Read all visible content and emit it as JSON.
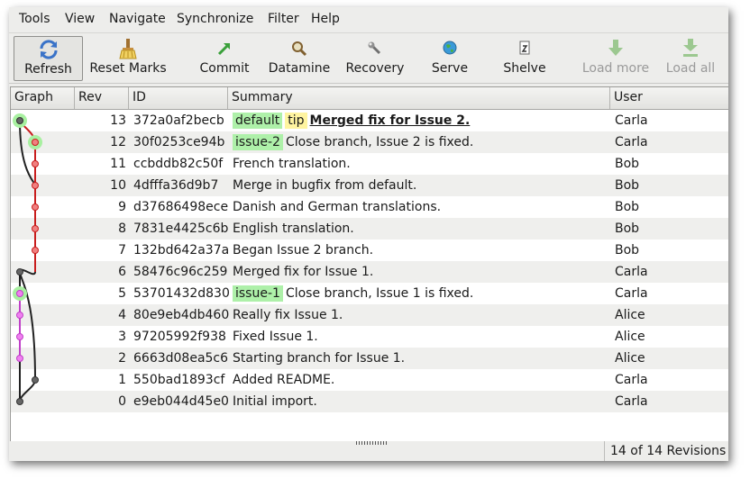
{
  "menu": [
    "Tools",
    "View",
    "Navigate",
    "Synchronize",
    "Filter",
    "Help"
  ],
  "toolbar": {
    "refresh": "Refresh",
    "reset_marks": "Reset Marks",
    "commit": "Commit",
    "datamine": "Datamine",
    "recovery": "Recovery",
    "serve": "Serve",
    "shelve": "Shelve",
    "load_more": "Load more",
    "load_all": "Load all"
  },
  "columns": {
    "graph": "Graph",
    "rev": "Rev",
    "id": "ID",
    "summary": "Summary",
    "user": "User"
  },
  "revisions": [
    {
      "rev": "13",
      "id": "372a0af2becb",
      "tags": [
        "default",
        "tip"
      ],
      "summary": "Merged fix for Issue 2.",
      "user": "Carla",
      "bold": true
    },
    {
      "rev": "12",
      "id": "30f0253ce94b",
      "tags": [
        "issue-2"
      ],
      "summary": "Close branch, Issue 2 is fixed.",
      "user": "Carla"
    },
    {
      "rev": "11",
      "id": "ccbddb82c50f",
      "tags": [],
      "summary": "French translation.",
      "user": "Bob"
    },
    {
      "rev": "10",
      "id": "4dfffa36d9b7",
      "tags": [],
      "summary": "Merge in bugfix from default.",
      "user": "Bob"
    },
    {
      "rev": "9",
      "id": "d37686498ece",
      "tags": [],
      "summary": "Danish and German translations.",
      "user": "Bob"
    },
    {
      "rev": "8",
      "id": "7831e4425c6b",
      "tags": [],
      "summary": "English translation.",
      "user": "Bob"
    },
    {
      "rev": "7",
      "id": "132bd642a37a",
      "tags": [],
      "summary": "Began Issue 2 branch.",
      "user": "Bob"
    },
    {
      "rev": "6",
      "id": "58476c96c259",
      "tags": [],
      "summary": "Merged fix for Issue 1.",
      "user": "Carla"
    },
    {
      "rev": "5",
      "id": "53701432d830",
      "tags": [
        "issue-1"
      ],
      "summary": "Close branch, Issue 1 is fixed.",
      "user": "Carla"
    },
    {
      "rev": "4",
      "id": "80e9eb4db460",
      "tags": [],
      "summary": "Really fix Issue 1.",
      "user": "Alice"
    },
    {
      "rev": "3",
      "id": "97205992f938",
      "tags": [],
      "summary": "Fixed Issue 1.",
      "user": "Alice"
    },
    {
      "rev": "2",
      "id": "6663d08ea5c6",
      "tags": [],
      "summary": "Starting branch for Issue 1.",
      "user": "Alice"
    },
    {
      "rev": "1",
      "id": "550bad1893cf",
      "tags": [],
      "summary": "Added README.",
      "user": "Carla"
    },
    {
      "rev": "0",
      "id": "e9eb044d45e0",
      "tags": [],
      "summary": "Initial import.",
      "user": "Carla"
    }
  ],
  "status": "14 of 14 Revisions",
  "colors": {
    "default_branch": "#222222",
    "issue2_branch": "#c81e1e",
    "issue1_branch": "#c040c8",
    "branch_tag_bg": "#aef0a9",
    "tip_tag_bg": "#fff4a0",
    "head_highlight": "#a8f0a0"
  }
}
